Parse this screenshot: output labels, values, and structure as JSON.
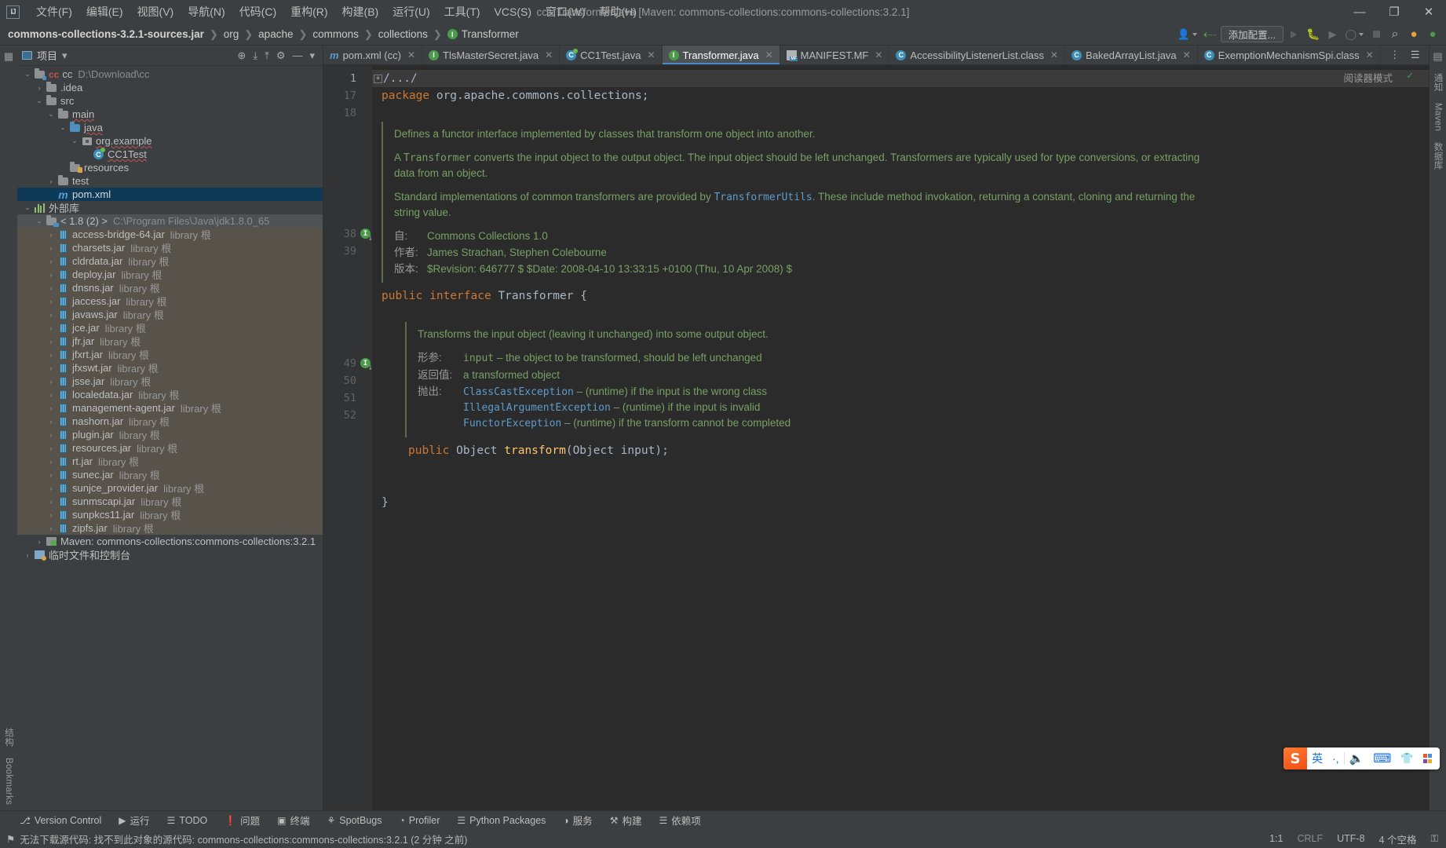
{
  "window": {
    "title": "cc - Transformer.java [Maven: commons-collections:commons-collections:3.2.1]",
    "logo": "IJ",
    "minimize": "—",
    "restore": "❐",
    "close": "✕"
  },
  "menubar": {
    "items": [
      {
        "label": "文件(F)",
        "name": "menu-file"
      },
      {
        "label": "编辑(E)",
        "name": "menu-edit"
      },
      {
        "label": "视图(V)",
        "name": "menu-view"
      },
      {
        "label": "导航(N)",
        "name": "menu-navigate"
      },
      {
        "label": "代码(C)",
        "name": "menu-code"
      },
      {
        "label": "重构(R)",
        "name": "menu-refactor"
      },
      {
        "label": "构建(B)",
        "name": "menu-build"
      },
      {
        "label": "运行(U)",
        "name": "menu-run"
      },
      {
        "label": "工具(T)",
        "name": "menu-tools"
      },
      {
        "label": "VCS(S)",
        "name": "menu-vcs"
      },
      {
        "label": "窗口(W)",
        "name": "menu-window"
      },
      {
        "label": "帮助(H)",
        "name": "menu-help"
      }
    ]
  },
  "navbar": {
    "crumbs": [
      {
        "label": "commons-collections-3.2.1-sources.jar",
        "strong": true
      },
      {
        "label": "org",
        "strong": false
      },
      {
        "label": "apache",
        "strong": false
      },
      {
        "label": "commons",
        "strong": false
      },
      {
        "label": "collections",
        "strong": false
      },
      {
        "label": "Transformer",
        "strong": false,
        "badge": "I"
      }
    ],
    "separator": "❯",
    "add_config_label": "添加配置...",
    "search_icon": "⌕",
    "updates_icon": "↑",
    "avatar_icon": "◐"
  },
  "project_panel": {
    "title": "项目",
    "dropdown_icon": "▾",
    "icons": [
      {
        "name": "locate-icon",
        "glyph": "⊕"
      },
      {
        "name": "expand-all-icon",
        "glyph": "⤓"
      },
      {
        "name": "collapse-all-icon",
        "glyph": "⤒"
      },
      {
        "name": "settings-gear-icon",
        "glyph": "⚙"
      },
      {
        "name": "hide-panel-icon",
        "glyph": "—"
      }
    ],
    "tree": [
      {
        "depth": 0,
        "arrow": "⌄",
        "icon": "module-folder",
        "label": "cc",
        "suffix": "D:\\Download\\cc",
        "suffix_type": "path",
        "state": "normal",
        "icon_text": "cc"
      },
      {
        "depth": 1,
        "arrow": "›",
        "icon": "folder",
        "label": ".idea",
        "suffix": "",
        "state": "normal"
      },
      {
        "depth": 1,
        "arrow": "⌄",
        "icon": "folder",
        "label": "src",
        "suffix": "",
        "state": "normal"
      },
      {
        "depth": 2,
        "arrow": "⌄",
        "icon": "folder",
        "label": "main",
        "suffix": "",
        "state": "normal",
        "squiggle": true
      },
      {
        "depth": 3,
        "arrow": "⌄",
        "icon": "folder-blue",
        "label": "java",
        "suffix": "",
        "state": "normal",
        "squiggle": true
      },
      {
        "depth": 4,
        "arrow": "⌄",
        "icon": "package",
        "label": "org.example",
        "suffix": "",
        "state": "normal",
        "squiggle": true
      },
      {
        "depth": 5,
        "arrow": "",
        "icon": "test-class",
        "label": "CC1Test",
        "suffix": "",
        "state": "normal",
        "squiggle": true
      },
      {
        "depth": 3,
        "arrow": "",
        "icon": "folder-resources",
        "label": "resources",
        "suffix": "",
        "state": "normal"
      },
      {
        "depth": 2,
        "arrow": "›",
        "icon": "folder",
        "label": "test",
        "suffix": "",
        "state": "normal"
      },
      {
        "depth": 2,
        "arrow": "",
        "icon": "maven-m",
        "label": "pom.xml",
        "suffix": "",
        "state": "selected"
      },
      {
        "depth": 0,
        "arrow": "⌄",
        "icon": "external-lib",
        "label": "外部库",
        "suffix": "",
        "state": "normal"
      },
      {
        "depth": 1,
        "arrow": "⌄",
        "icon": "jdk-folder",
        "label": "< 1.8 (2) >",
        "suffix": "C:\\Program Files\\Java\\jdk1.8.0_65",
        "suffix_type": "path",
        "state": "hover"
      },
      {
        "depth": 2,
        "arrow": "›",
        "icon": "jar",
        "label": "access-bridge-64.jar",
        "suffix": "library 根",
        "suffix_type": "lib",
        "state": "lib"
      },
      {
        "depth": 2,
        "arrow": "›",
        "icon": "jar",
        "label": "charsets.jar",
        "suffix": "library 根",
        "suffix_type": "lib",
        "state": "lib"
      },
      {
        "depth": 2,
        "arrow": "›",
        "icon": "jar",
        "label": "cldrdata.jar",
        "suffix": "library 根",
        "suffix_type": "lib",
        "state": "lib"
      },
      {
        "depth": 2,
        "arrow": "›",
        "icon": "jar",
        "label": "deploy.jar",
        "suffix": "library 根",
        "suffix_type": "lib",
        "state": "lib"
      },
      {
        "depth": 2,
        "arrow": "›",
        "icon": "jar",
        "label": "dnsns.jar",
        "suffix": "library 根",
        "suffix_type": "lib",
        "state": "lib"
      },
      {
        "depth": 2,
        "arrow": "›",
        "icon": "jar",
        "label": "jaccess.jar",
        "suffix": "library 根",
        "suffix_type": "lib",
        "state": "lib"
      },
      {
        "depth": 2,
        "arrow": "›",
        "icon": "jar",
        "label": "javaws.jar",
        "suffix": "library 根",
        "suffix_type": "lib",
        "state": "lib"
      },
      {
        "depth": 2,
        "arrow": "›",
        "icon": "jar",
        "label": "jce.jar",
        "suffix": "library 根",
        "suffix_type": "lib",
        "state": "lib"
      },
      {
        "depth": 2,
        "arrow": "›",
        "icon": "jar",
        "label": "jfr.jar",
        "suffix": "library 根",
        "suffix_type": "lib",
        "state": "lib"
      },
      {
        "depth": 2,
        "arrow": "›",
        "icon": "jar",
        "label": "jfxrt.jar",
        "suffix": "library 根",
        "suffix_type": "lib",
        "state": "lib"
      },
      {
        "depth": 2,
        "arrow": "›",
        "icon": "jar",
        "label": "jfxswt.jar",
        "suffix": "library 根",
        "suffix_type": "lib",
        "state": "lib"
      },
      {
        "depth": 2,
        "arrow": "›",
        "icon": "jar",
        "label": "jsse.jar",
        "suffix": "library 根",
        "suffix_type": "lib",
        "state": "lib"
      },
      {
        "depth": 2,
        "arrow": "›",
        "icon": "jar",
        "label": "localedata.jar",
        "suffix": "library 根",
        "suffix_type": "lib",
        "state": "lib"
      },
      {
        "depth": 2,
        "arrow": "›",
        "icon": "jar",
        "label": "management-agent.jar",
        "suffix": "library 根",
        "suffix_type": "lib",
        "state": "lib"
      },
      {
        "depth": 2,
        "arrow": "›",
        "icon": "jar",
        "label": "nashorn.jar",
        "suffix": "library 根",
        "suffix_type": "lib",
        "state": "lib"
      },
      {
        "depth": 2,
        "arrow": "›",
        "icon": "jar",
        "label": "plugin.jar",
        "suffix": "library 根",
        "suffix_type": "lib",
        "state": "lib"
      },
      {
        "depth": 2,
        "arrow": "›",
        "icon": "jar",
        "label": "resources.jar",
        "suffix": "library 根",
        "suffix_type": "lib",
        "state": "lib"
      },
      {
        "depth": 2,
        "arrow": "›",
        "icon": "jar",
        "label": "rt.jar",
        "suffix": "library 根",
        "suffix_type": "lib",
        "state": "lib"
      },
      {
        "depth": 2,
        "arrow": "›",
        "icon": "jar",
        "label": "sunec.jar",
        "suffix": "library 根",
        "suffix_type": "lib",
        "state": "lib"
      },
      {
        "depth": 2,
        "arrow": "›",
        "icon": "jar",
        "label": "sunjce_provider.jar",
        "suffix": "library 根",
        "suffix_type": "lib",
        "state": "lib"
      },
      {
        "depth": 2,
        "arrow": "›",
        "icon": "jar",
        "label": "sunmscapi.jar",
        "suffix": "library 根",
        "suffix_type": "lib",
        "state": "lib"
      },
      {
        "depth": 2,
        "arrow": "›",
        "icon": "jar",
        "label": "sunpkcs11.jar",
        "suffix": "library 根",
        "suffix_type": "lib",
        "state": "lib"
      },
      {
        "depth": 2,
        "arrow": "›",
        "icon": "jar",
        "label": "zipfs.jar",
        "suffix": "library 根",
        "suffix_type": "lib",
        "state": "lib"
      },
      {
        "depth": 1,
        "arrow": "›",
        "icon": "maven-lib",
        "label": "Maven: commons-collections:commons-collections:3.2.1",
        "suffix": "",
        "state": "normal"
      },
      {
        "depth": 0,
        "arrow": "›",
        "icon": "scratch",
        "label": "临时文件和控制台",
        "suffix": "",
        "state": "normal"
      }
    ]
  },
  "tabs": {
    "items": [
      {
        "label": "pom.xml (cc)",
        "icon": "maven-m",
        "active": false
      },
      {
        "label": "TlsMasterSecret.java",
        "icon": "interface-green",
        "active": false
      },
      {
        "label": "CC1Test.java",
        "icon": "test-class",
        "active": false
      },
      {
        "label": "Transformer.java",
        "icon": "interface-green",
        "active": true
      },
      {
        "label": "MANIFEST.MF",
        "icon": "manifest",
        "active": false
      },
      {
        "label": "AccessibilityListenerList.class",
        "icon": "class-cyan",
        "active": false
      },
      {
        "label": "BakedArrayList.java",
        "icon": "class-cyan",
        "active": false
      },
      {
        "label": "ExemptionMechanismSpi.class",
        "icon": "class-cyan",
        "active": false
      }
    ],
    "close_glyph": "✕",
    "more_glyph": "⋮",
    "list_glyph": "☰"
  },
  "editor": {
    "reader_mode_label": "阅读器模式",
    "inspection_glyph": "✓",
    "fold_text": "/.../",
    "fold_box": "+",
    "line_numbers": [
      "1",
      "17",
      "18",
      "38",
      "39",
      "49",
      "50",
      "51",
      "52"
    ],
    "package_kw": "package",
    "package_name": " org.apache.commons.collections;",
    "class_doc": {
      "p1": "Defines a functor interface implemented by classes that transform one object into another.",
      "p2_a": "A ",
      "p2_mono": "Transformer",
      "p2_b": " converts the input object to the output object. The input object should be left unchanged. Transformers are typically used for type conversions, or extracting data from an object.",
      "p3_a": "Standard implementations of common transformers are provided by ",
      "p3_link": "TransformerUtils",
      "p3_b": ". These include method invokation, returning a constant, cloning and returning the string value.",
      "since_tag": "自:",
      "since_val": "Commons Collections 1.0",
      "author_tag": "作者:",
      "author_val": "James Strachan, Stephen Colebourne",
      "version_tag": "版本:",
      "version_val": "$Revision: 646777 $ $Date: 2008-04-10 13:33:15 +0100 (Thu, 10 Apr 2008) $"
    },
    "interface_decl": {
      "kw1": "public",
      "kw2": "interface",
      "name": "Transformer",
      "brace": "{"
    },
    "method_doc": {
      "p1": "Transforms the input object (leaving it unchanged) into some output object.",
      "param_tag": "形参:",
      "param_name": "input",
      "param_desc": " – the object to be transformed, should be left unchanged",
      "return_tag": "返回值:",
      "return_val": "a transformed object",
      "throws_tag": "抛出:",
      "throws": [
        {
          "exc": "ClassCastException",
          "desc": " – (runtime) if the input is the wrong class"
        },
        {
          "exc": "IllegalArgumentException",
          "desc": " – (runtime) if the input is invalid"
        },
        {
          "exc": "FunctorException",
          "desc": " – (runtime) if the transform cannot be completed"
        }
      ]
    },
    "method_decl": {
      "kw": "public",
      "rtype": "Object",
      "name": "transform",
      "args_a": "(",
      "arg_type": "Object",
      "arg_name": " input",
      "args_b": ");"
    },
    "close_brace": "}",
    "gutter_marks": {
      "interface": "I",
      "method": "I"
    }
  },
  "right_rail": {
    "items": [
      "通知",
      "Maven",
      "数据库"
    ]
  },
  "left_rail": {
    "items": [
      "结构",
      "Bookmarks"
    ]
  },
  "bottom_tools": {
    "items": [
      {
        "label": "Version Control",
        "icon": "⎇"
      },
      {
        "label": "运行",
        "icon": "▶"
      },
      {
        "label": "TODO",
        "icon": "☰"
      },
      {
        "label": "问题",
        "icon": "❗",
        "icon_color": "red"
      },
      {
        "label": "终端",
        "icon": "▣"
      },
      {
        "label": "SpotBugs",
        "icon": "⚘"
      },
      {
        "label": "Profiler",
        "icon": "◔"
      },
      {
        "label": "Python Packages",
        "icon": "☰"
      },
      {
        "label": "服务",
        "icon": "◑"
      },
      {
        "label": "构建",
        "icon": "⚒"
      },
      {
        "label": "依赖项",
        "icon": "☰"
      }
    ]
  },
  "statusbar": {
    "message_icon": "⚑",
    "message": "无法下载源代码: 找不到此对象的源代码: commons-collections:commons-collections:3.2.1 (2 分钟 之前)",
    "caret": "1:1",
    "line_sep": "CRLF",
    "encoding": "UTF-8",
    "indent": "4 个空格",
    "lock_icon": "⚿"
  },
  "ime": {
    "logo": "S",
    "mode": "英",
    "punct": "·,",
    "mic": "ᴴ",
    "keyboard": "⌨",
    "shirt": "▼",
    "apps": "⊞"
  },
  "colors": {
    "accent": "#4a88c7",
    "keyword": "#cc7832",
    "doc": "#77a064",
    "link": "#5c9ccc",
    "selection": "#0d3a58",
    "lib_row": "#57534a",
    "editor_bg": "#2b2b2b",
    "panel_bg": "#3c3f41"
  }
}
